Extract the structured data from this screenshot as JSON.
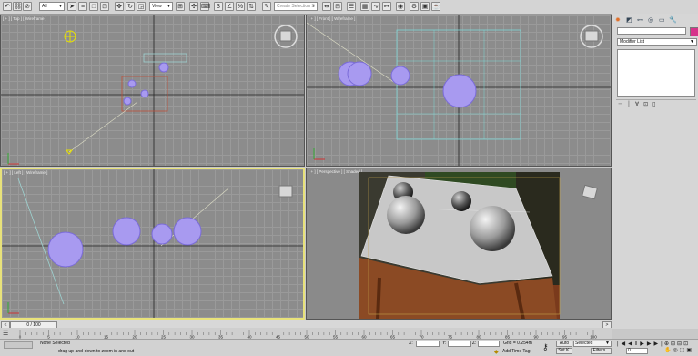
{
  "toolbar": {
    "filter_value": "All",
    "view_value": "View",
    "selection_set_placeholder": "Create Selection S",
    "icons": [
      "undo-icon",
      "redo-icon",
      "link-icon",
      "unlink-icon",
      "bind-space-warp-icon",
      "select-filter",
      "select-object-icon",
      "select-by-name-icon",
      "rect-selection-icon",
      "window-crossing-icon",
      "move-icon",
      "rotate-icon",
      "scale-icon",
      "reference-coord",
      "pivot-icon",
      "manipulate-icon",
      "keyboard-shortcut-icon",
      "snap-icon",
      "angle-snap-icon",
      "percent-snap-icon",
      "spinner-snap-icon",
      "edit-named-sel-icon",
      "named-selection",
      "mirror-icon",
      "align-icon",
      "layer-manager-icon",
      "graphite-icon",
      "curve-editor-icon",
      "schematic-icon",
      "material-editor-icon",
      "render-setup-icon",
      "rendered-frame-icon",
      "render-icon"
    ]
  },
  "viewports": {
    "top": {
      "label": "[ + ] [ Top ] [ Wireframe ]"
    },
    "front": {
      "label": "[ + ] [ Front ] [ Wireframe ]"
    },
    "left": {
      "label": "[ + ] [ Left ] [ Wireframe ]"
    },
    "perspective": {
      "label": "[ + ] [ Perspective ] [ Shaded ]"
    }
  },
  "command_panel": {
    "tabs": [
      "create-tab-icon",
      "modify-tab-icon",
      "hierarchy-tab-icon",
      "motion-tab-icon",
      "display-tab-icon",
      "utilities-tab-icon"
    ],
    "modifier_list": "Modifier List",
    "swatch_color": "#d6338a"
  },
  "timeline": {
    "frame_display": "0 / 100",
    "ticks": [
      "0",
      "5",
      "10",
      "15",
      "20",
      "25",
      "30",
      "35",
      "40",
      "45",
      "50",
      "55",
      "60",
      "65",
      "70",
      "75",
      "80",
      "85",
      "90",
      "95",
      "100"
    ]
  },
  "status": {
    "selection": "None Selected",
    "prompt": "Click or click-and-drag to select objects",
    "hint": "drag up-and-down to zoom in and out",
    "x_label": "X:",
    "y_label": "Y:",
    "z_label": "Z:",
    "grid": "Grid = 0.254m",
    "add_time_tag": "Add Time Tag",
    "auto_key": "Auto",
    "set_key": "Set K.",
    "key_mode": "Selected",
    "filters": "Filters...",
    "frame": "0"
  }
}
